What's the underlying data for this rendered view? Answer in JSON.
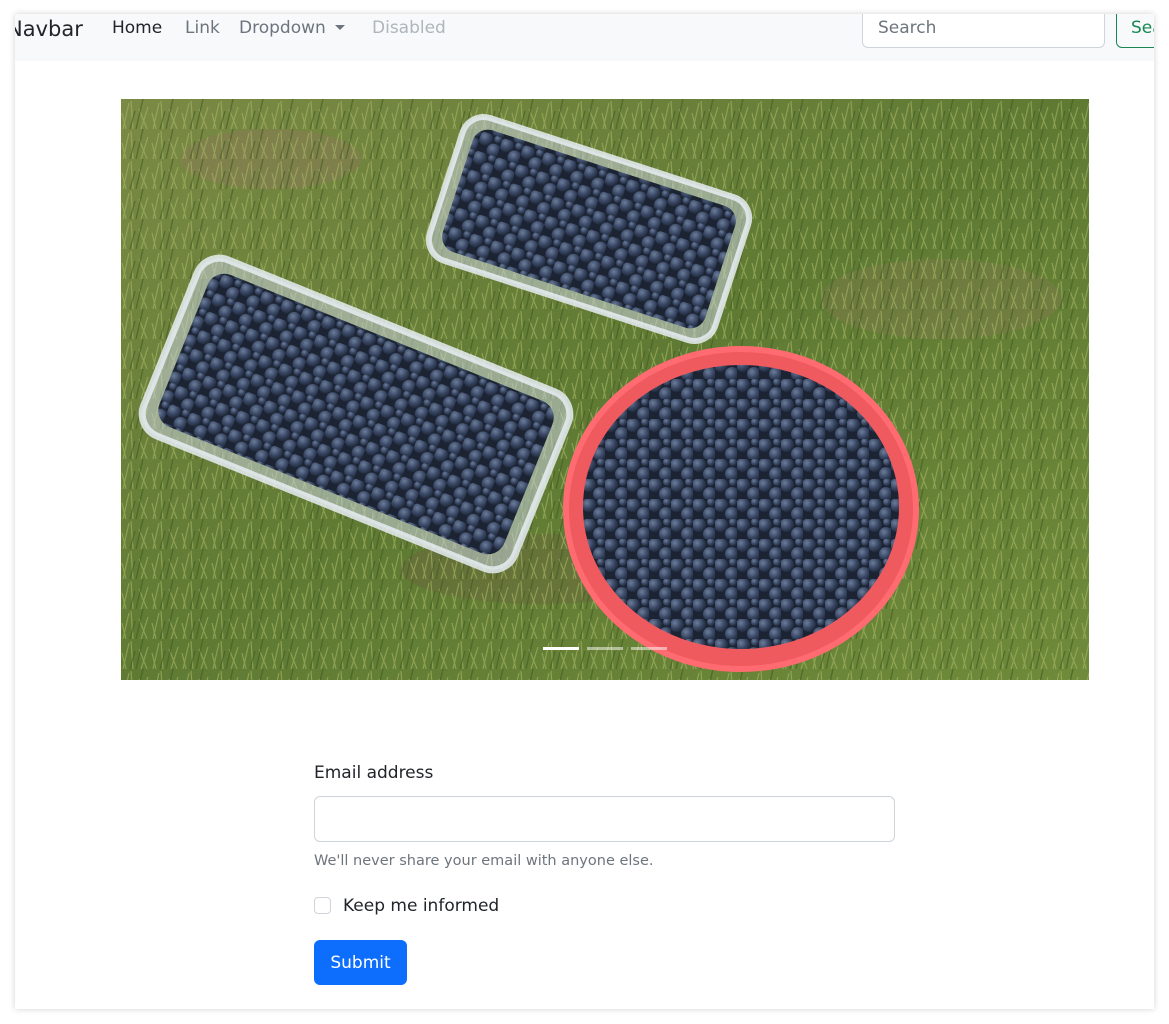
{
  "navbar": {
    "brand": "Navbar",
    "links": [
      {
        "label": "Home",
        "active": true
      },
      {
        "label": "Link"
      },
      {
        "label": "Dropdown"
      },
      {
        "label": "Disabled",
        "disabled": true
      }
    ],
    "search_placeholder": "Search",
    "search_button": "Search"
  },
  "carousel": {
    "slide_count": 3,
    "active_index": 0,
    "image_description_icon": "photo-blueberries"
  },
  "form": {
    "email_label": "Email address",
    "email_value": "",
    "email_help": "We'll never share your email with anyone else.",
    "checkbox_label": "Keep me informed",
    "checkbox_checked": false,
    "submit_label": "Submit"
  },
  "colors": {
    "primary": "#0d6efd",
    "success": "#198754",
    "navbar_bg": "#f8f9fa"
  }
}
